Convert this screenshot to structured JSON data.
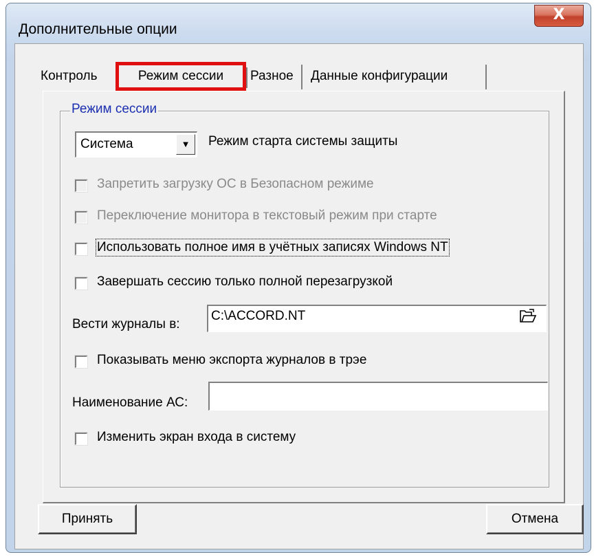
{
  "window": {
    "title": "Дополнительные опции",
    "close_label": "X"
  },
  "tabs": [
    {
      "label": "Контроль"
    },
    {
      "label": "Режим сессии",
      "active": true
    },
    {
      "label": "Разное"
    },
    {
      "label": "Данные конфигурации"
    }
  ],
  "group": {
    "legend": "Режим сессии",
    "mode_select": {
      "value": "Система",
      "arrow": "▼"
    },
    "mode_label": "Режим старта системы защиты",
    "checkboxes": [
      {
        "label": "Запретить загрузку ОС в Безопасном режиме",
        "enabled": false,
        "checked": false
      },
      {
        "label": "Переключение монитора в текстовый режим при старте",
        "enabled": false,
        "checked": false
      },
      {
        "label": "Использовать полное имя в учётных записях Windows NT",
        "enabled": true,
        "checked": false
      },
      {
        "label": "Завершать сессию только полной перезагрузкой",
        "enabled": true,
        "checked": false
      },
      {
        "label": "Показывать меню экспорта журналов в трэе",
        "enabled": true,
        "checked": false
      },
      {
        "label": "Изменить экран входа в систему",
        "enabled": true,
        "checked": false
      }
    ],
    "logs_label": "Вести журналы в:",
    "logs_path": "C:\\ACCORD.NT",
    "as_name_label": "Наименование АС:",
    "as_name_value": ""
  },
  "buttons": {
    "accept": "Принять",
    "cancel": "Отмена"
  },
  "colors": {
    "highlight": "#e01010",
    "legend": "#1b2fb0"
  },
  "icons": {
    "browse": "folder-open-icon",
    "close": "close-icon"
  }
}
